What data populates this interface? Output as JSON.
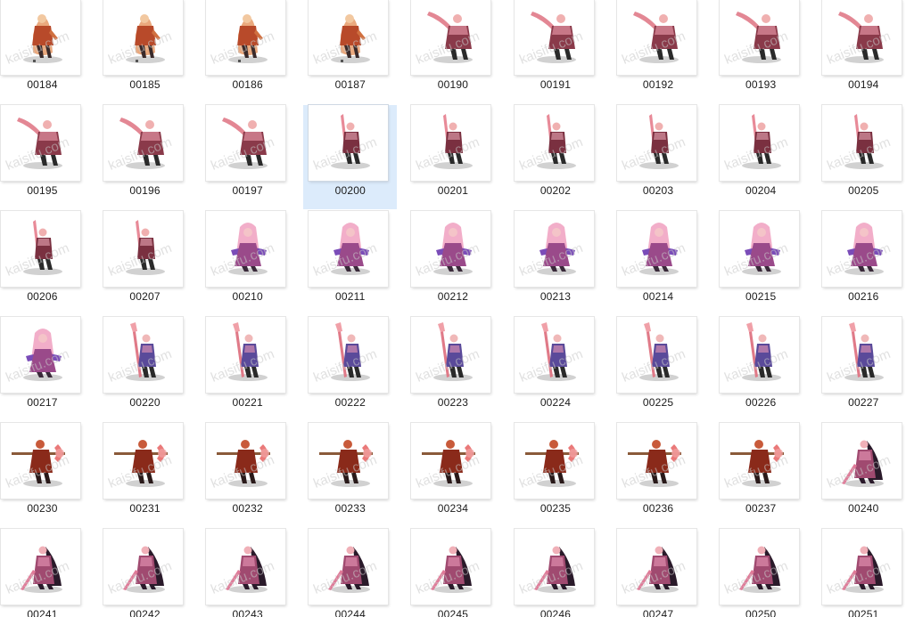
{
  "files": [
    {
      "label": "00184",
      "figure": "warrior-orange"
    },
    {
      "label": "00185",
      "figure": "warrior-orange"
    },
    {
      "label": "00186",
      "figure": "warrior-orange"
    },
    {
      "label": "00187",
      "figure": "warrior-orange"
    },
    {
      "label": "00190",
      "figure": "swordsman-pink"
    },
    {
      "label": "00191",
      "figure": "swordsman-pink"
    },
    {
      "label": "00192",
      "figure": "swordsman-pink"
    },
    {
      "label": "00193",
      "figure": "swordsman-pink"
    },
    {
      "label": "00194",
      "figure": "swordsman-pink"
    },
    {
      "label": "00195",
      "figure": "swordsman-pink"
    },
    {
      "label": "00196",
      "figure": "swordsman-pink"
    },
    {
      "label": "00197",
      "figure": "swordsman-pink"
    },
    {
      "label": "00200",
      "figure": "standing-sword",
      "selected": true
    },
    {
      "label": "00201",
      "figure": "standing-sword"
    },
    {
      "label": "00202",
      "figure": "standing-sword"
    },
    {
      "label": "00203",
      "figure": "standing-sword"
    },
    {
      "label": "00204",
      "figure": "standing-sword"
    },
    {
      "label": "00205",
      "figure": "standing-sword"
    },
    {
      "label": "00206",
      "figure": "standing-sword"
    },
    {
      "label": "00207",
      "figure": "standing-sword"
    },
    {
      "label": "00210",
      "figure": "mage-purple"
    },
    {
      "label": "00211",
      "figure": "mage-purple"
    },
    {
      "label": "00212",
      "figure": "mage-purple"
    },
    {
      "label": "00213",
      "figure": "mage-purple"
    },
    {
      "label": "00214",
      "figure": "mage-purple"
    },
    {
      "label": "00215",
      "figure": "mage-purple"
    },
    {
      "label": "00216",
      "figure": "mage-purple"
    },
    {
      "label": "00217",
      "figure": "mage-purple"
    },
    {
      "label": "00220",
      "figure": "spearman-purple"
    },
    {
      "label": "00221",
      "figure": "spearman-purple"
    },
    {
      "label": "00222",
      "figure": "spearman-purple"
    },
    {
      "label": "00223",
      "figure": "spearman-purple"
    },
    {
      "label": "00224",
      "figure": "spearman-purple"
    },
    {
      "label": "00225",
      "figure": "spearman-purple"
    },
    {
      "label": "00226",
      "figure": "spearman-purple"
    },
    {
      "label": "00227",
      "figure": "spearman-purple"
    },
    {
      "label": "00230",
      "figure": "axeman-red"
    },
    {
      "label": "00231",
      "figure": "axeman-red"
    },
    {
      "label": "00232",
      "figure": "axeman-red"
    },
    {
      "label": "00233",
      "figure": "axeman-red"
    },
    {
      "label": "00234",
      "figure": "axeman-red"
    },
    {
      "label": "00235",
      "figure": "axeman-red"
    },
    {
      "label": "00236",
      "figure": "axeman-red"
    },
    {
      "label": "00237",
      "figure": "axeman-red"
    },
    {
      "label": "00240",
      "figure": "caped-lancer"
    },
    {
      "label": "00241",
      "figure": "caped-lancer"
    },
    {
      "label": "00242",
      "figure": "caped-lancer"
    },
    {
      "label": "00243",
      "figure": "caped-lancer"
    },
    {
      "label": "00244",
      "figure": "caped-lancer"
    },
    {
      "label": "00245",
      "figure": "caped-lancer"
    },
    {
      "label": "00246",
      "figure": "caped-lancer"
    },
    {
      "label": "00247",
      "figure": "caped-lancer"
    },
    {
      "label": "00250",
      "figure": "caped-lancer"
    },
    {
      "label": "00251",
      "figure": "caped-lancer"
    }
  ],
  "watermark": "kaisifu.com",
  "colors": {
    "selection": "#dcebfb",
    "label_text": "#1a1a1a"
  }
}
